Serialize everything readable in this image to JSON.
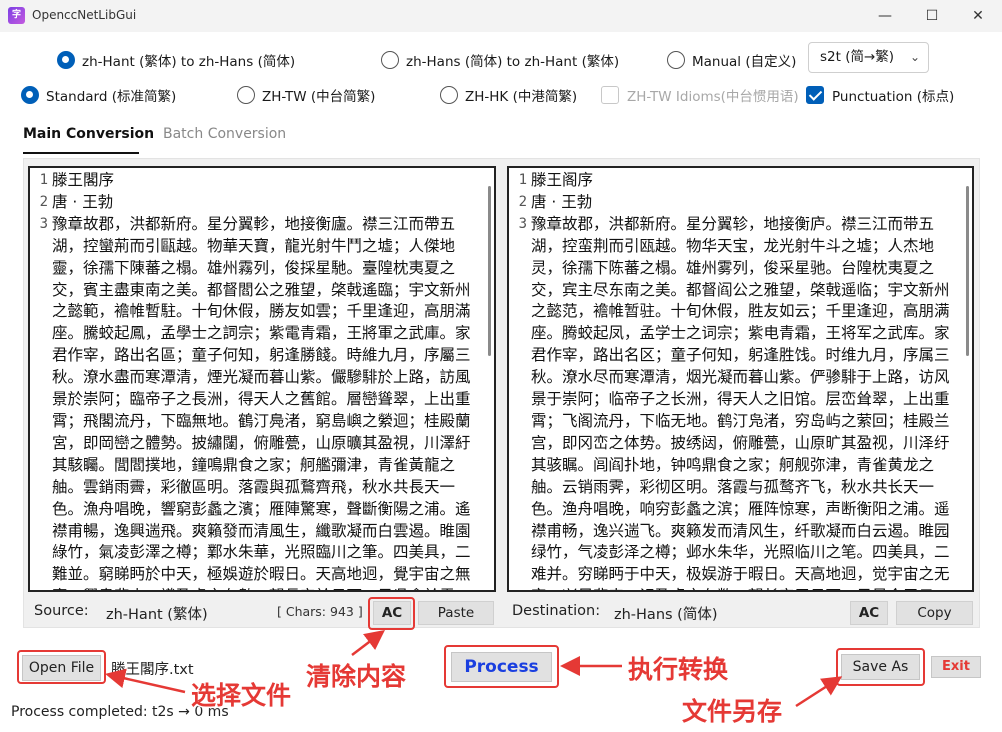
{
  "window": {
    "title": "OpenccNetLibGui",
    "icon_glyph": "字",
    "minimize": "—",
    "maximize": "☐",
    "close": "✕"
  },
  "conversion_options": [
    {
      "label": "zh-Hant (繁体) to zh-Hans (简体)",
      "selected": true
    },
    {
      "label": "zh-Hans (简体) to zh-Hant (繁体)",
      "selected": false
    },
    {
      "label": "Manual (自定义)",
      "selected": false
    }
  ],
  "config_select": {
    "value": "s2t (简→繁)",
    "chevron_icon": "chevron-down-icon"
  },
  "region_options": [
    {
      "label": "Standard (标准简繁)",
      "selected": true
    },
    {
      "label": "ZH-TW (中台简繁)",
      "selected": false
    },
    {
      "label": "ZH-HK (中港简繁)",
      "selected": false
    }
  ],
  "checkboxes": {
    "idioms": {
      "label": "ZH-TW Idioms(中台惯用语)",
      "checked": false,
      "disabled": true
    },
    "punctuation": {
      "label": "Punctuation (标点)",
      "checked": true
    }
  },
  "tabs": [
    {
      "label": "Main Conversion",
      "active": true
    },
    {
      "label": "Batch Conversion",
      "active": false
    }
  ],
  "source_editor": {
    "line_numbers": [
      "1",
      "2",
      "3"
    ],
    "text": "滕王閣序\n唐 · 王勃\n豫章故郡，洪都新府。星分翼軫，地接衡廬。襟三江而帶五\n湖，控蠻荊而引甌越。物華天寶，龍光射牛鬥之墟；人傑地\n靈，徐孺下陳蕃之榻。雄州霧列，俊採星馳。臺隍枕夷夏之\n交，賓主盡東南之美。都督閻公之雅望，棨戟遙臨；宇文新州\n之懿範，襜帷暫駐。十旬休假，勝友如雲；千里逢迎，高朋滿\n座。騰蛟起鳳，孟學士之詞宗；紫電青霜，王將軍之武庫。家\n君作宰，路出名區；童子何知，躬逢勝餞。時維九月，序屬三\n秋。潦水盡而寒潭清，煙光凝而暮山紫。儼驂騑於上路，訪風\n景於崇阿；臨帝子之長洲，得天人之舊館。層巒聳翠，上出重\n霄；飛閣流丹，下臨無地。鶴汀鳧渚，窮島嶼之縈迴；桂殿蘭\n宮，即岡巒之體勢。披繡闥，俯雕甍，山原曠其盈視，川澤紆\n其駭矚。閭閻撲地，鐘鳴鼎食之家；舸艦彌津，青雀黃龍之\n舳。雲銷雨霽，彩徹區明。落霞與孤鶩齊飛，秋水共長天一\n色。漁舟唱晚，響窮彭蠡之濱；雁陣驚寒，聲斷衡陽之浦。遙\n襟甫暢，逸興遄飛。爽籟發而清風生，纖歌凝而白雲遏。睢園\n綠竹，氣凌彭澤之樽；鄴水朱華，光照臨川之筆。四美具，二\n難並。窮睇眄於中天，極娛遊於暇日。天高地迥，覺宇宙之無\n窮；興盡悲來，識盈虛之有數。望長安於日下，目吳會於雲"
  },
  "dest_editor": {
    "line_numbers": [
      "1",
      "2",
      "3"
    ],
    "text": "滕王阁序\n唐 · 王勃\n豫章故郡，洪都新府。星分翼轸，地接衡庐。襟三江而带五\n湖，控蛮荆而引瓯越。物华天宝，龙光射牛斗之墟；人杰地\n灵，徐孺下陈蕃之榻。雄州雾列，俊采星驰。台隍枕夷夏之\n交，宾主尽东南之美。都督阎公之雅望，棨戟遥临；宇文新州\n之懿范，襜帷暂驻。十旬休假，胜友如云；千里逢迎，高朋满\n座。腾蛟起凤，孟学士之词宗；紫电青霜，王将军之武库。家\n君作宰，路出名区；童子何知，躬逢胜饯。时维九月，序属三\n秋。潦水尽而寒潭清，烟光凝而暮山紫。俨骖騑于上路，访风\n景于崇阿；临帝子之长洲，得天人之旧馆。层峦耸翠，上出重\n霄；飞阁流丹，下临无地。鹤汀凫渚，穷岛屿之萦回；桂殿兰\n宫，即冈峦之体势。披绣闼，俯雕甍，山原旷其盈视，川泽纡\n其骇瞩。闾阎扑地，钟鸣鼎食之家；舸舰弥津，青雀黄龙之\n舳。云销雨霁，彩彻区明。落霞与孤鹜齐飞，秋水共长天一\n色。渔舟唱晚，响穷彭蠡之滨；雁阵惊寒，声断衡阳之浦。遥\n襟甫畅，逸兴遄飞。爽籁发而清风生，纤歌凝而白云遏。睢园\n绿竹，气凌彭泽之樽；邺水朱华，光照临川之笔。四美具，二\n难并。穷睇眄于中天，极娱游于暇日。天高地迥，觉宇宙之无\n穷；兴尽悲来，识盈虚之有数。望长安于日下，目吴会于云"
  },
  "source_bar": {
    "label": "Source:",
    "value": "zh-Hant (繁体)",
    "chars": "[ Chars: 943 ]",
    "ac": "AC",
    "paste": "Paste"
  },
  "dest_bar": {
    "label": "Destination:",
    "value": "zh-Hans (简体)",
    "ac": "AC",
    "copy": "Copy"
  },
  "bottom": {
    "open_file": "Open File",
    "filename": "滕王閣序.txt",
    "process": "Process",
    "save_as": "Save As",
    "exit": "Exit",
    "status": "Process completed: t2s → 0 ms"
  },
  "annotations": {
    "clear": "清除内容",
    "select_file": "选择文件",
    "execute": "执行转换",
    "save_file": "文件另存"
  },
  "colors": {
    "accent": "#005fb8",
    "annotation": "#e53935",
    "process_text": "#1a3fe0",
    "exit_text": "#e53935"
  }
}
